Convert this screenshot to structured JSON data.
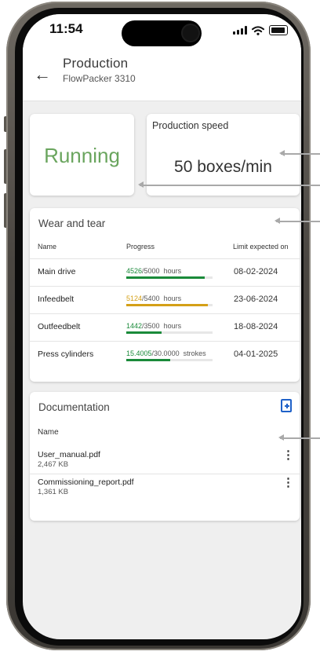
{
  "status_bar": {
    "time": "11:54",
    "signal_icon": "cellular-signal-icon",
    "wifi_icon": "wifi-icon",
    "battery_icon": "battery-icon"
  },
  "app_bar": {
    "back_icon": "arrow-back-icon",
    "back_glyph": "←",
    "title": "Production",
    "subtitle": "FlowPacker 3310"
  },
  "status_card": {
    "status": "Running",
    "status_color": "#6aa55e"
  },
  "speed_card": {
    "label": "Production speed",
    "value": "50 boxes/min"
  },
  "wear_card": {
    "title": "Wear and tear",
    "columns": {
      "name": "Name",
      "progress": "Progress",
      "limit": "Limit expected on"
    },
    "rows": [
      {
        "name": "Main drive",
        "current": "4526",
        "total": "/5000",
        "unit": "hours",
        "progress": 0.905,
        "color": "#1a8a3a",
        "limit": "08-02-2024"
      },
      {
        "name": "Infeedbelt",
        "current": "5124",
        "total": "/5400",
        "unit": "hours",
        "progress": 0.949,
        "color": "#d4a017",
        "limit": "23-06-2024"
      },
      {
        "name": "Outfeedbelt",
        "current": "1442",
        "total": "/3500",
        "unit": "hours",
        "progress": 0.412,
        "color": "#1a8a3a",
        "limit": "18-08-2024"
      },
      {
        "name": "Press cylinders",
        "current": "15.4005",
        "total": "/30.0000",
        "unit": "strokes",
        "progress": 0.513,
        "color": "#1a8a3a",
        "limit": "04-01-2025"
      }
    ]
  },
  "docs_card": {
    "title": "Documentation",
    "add_icon": "add-document-icon",
    "accent": "#1f61c8",
    "column_name": "Name",
    "files": [
      {
        "name": "User_manual.pdf",
        "size": "2,467 KB",
        "menu_glyph": "⋮"
      },
      {
        "name": "Commissioning_report.pdf",
        "size": "1,361 KB",
        "menu_glyph": "⋮"
      }
    ]
  }
}
